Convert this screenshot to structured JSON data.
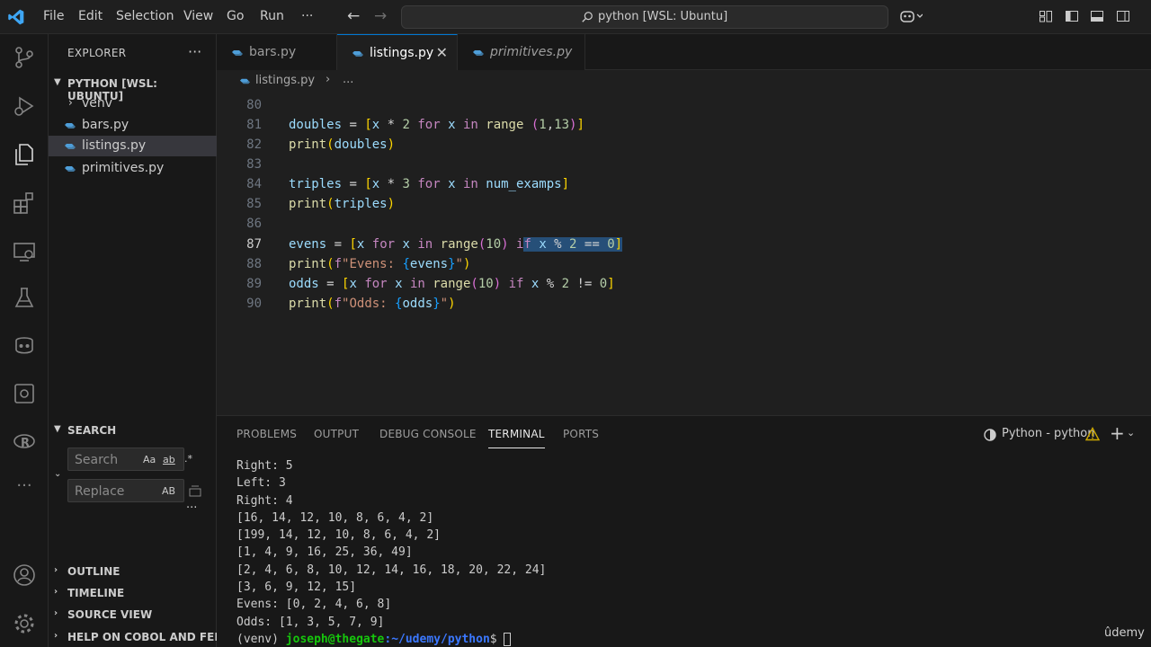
{
  "menu": [
    "File",
    "Edit",
    "Selection",
    "View",
    "Go",
    "Run",
    "···"
  ],
  "command_center": "python [WSL: Ubuntu]",
  "sidebar": {
    "title": "EXPLORER",
    "dots": "···",
    "root": "PYTHON [WSL: UBUNTU]",
    "items": [
      {
        "label": "venv",
        "type": "folder"
      },
      {
        "label": "bars.py",
        "type": "file"
      },
      {
        "label": "listings.py",
        "type": "file",
        "selected": true
      },
      {
        "label": "primitives.py",
        "type": "file"
      }
    ],
    "search": {
      "title": "SEARCH",
      "search_placeholder": "Search",
      "replace_placeholder": "Replace",
      "opt_case": "Aa",
      "opt_word": "ab",
      "opt_regex": ".*",
      "opt_preserve": "AB"
    },
    "sections": [
      "OUTLINE",
      "TIMELINE",
      "SOURCE VIEW",
      "HELP ON COBOL AND FEE..."
    ]
  },
  "tabs": [
    {
      "label": "bars.py"
    },
    {
      "label": "listings.py",
      "active": true
    },
    {
      "label": "primitives.py"
    }
  ],
  "breadcrumb": {
    "file": "listings.py",
    "sep": "›",
    "more": "..."
  },
  "line_numbers": [
    "80",
    "81",
    "82",
    "83",
    "84",
    "85",
    "86",
    "87",
    "88",
    "89",
    "90"
  ],
  "code_text": {
    "l81_var": "doubles",
    "l81_rest": "x * 2 for x in range (1,13)",
    "l82": "print(doubles)",
    "l84_var": "triples",
    "l85": "print(triples)",
    "l87_var": "evens",
    "l88": "print(f\"Evens: {evens}\")",
    "l89_var": "odds",
    "l90": "print(f\"Odds: {odds}\")"
  },
  "panel": {
    "tabs": [
      "PROBLEMS",
      "OUTPUT",
      "DEBUG CONSOLE",
      "TERMINAL",
      "PORTS"
    ],
    "active_tab": "TERMINAL",
    "terminal_name": "Python - python",
    "terminal_lines": [
      "Right: 5",
      "Left: 3",
      "Right: 4",
      "[16, 14, 12, 10, 8, 6, 4, 2]",
      "[199, 14, 12, 10, 8, 6, 4, 2]",
      "[1, 4, 9, 16, 25, 36, 49]",
      "[2, 4, 6, 8, 10, 12, 14, 16, 18, 20, 22, 24]",
      "[3, 6, 9, 12, 15]",
      "Evens: [0, 2, 4, 6, 8]",
      "Odds: [1, 3, 5, 7, 9]"
    ],
    "prompt_env": "(venv)",
    "prompt_user": "joseph@thegate",
    "prompt_path": ":~/udemy/python",
    "prompt_dollar": "$"
  },
  "watermark": "ûdemy",
  "colors": {
    "accent": "#0078d4",
    "selection": "#264f78",
    "bg": "#1f1f1f"
  }
}
